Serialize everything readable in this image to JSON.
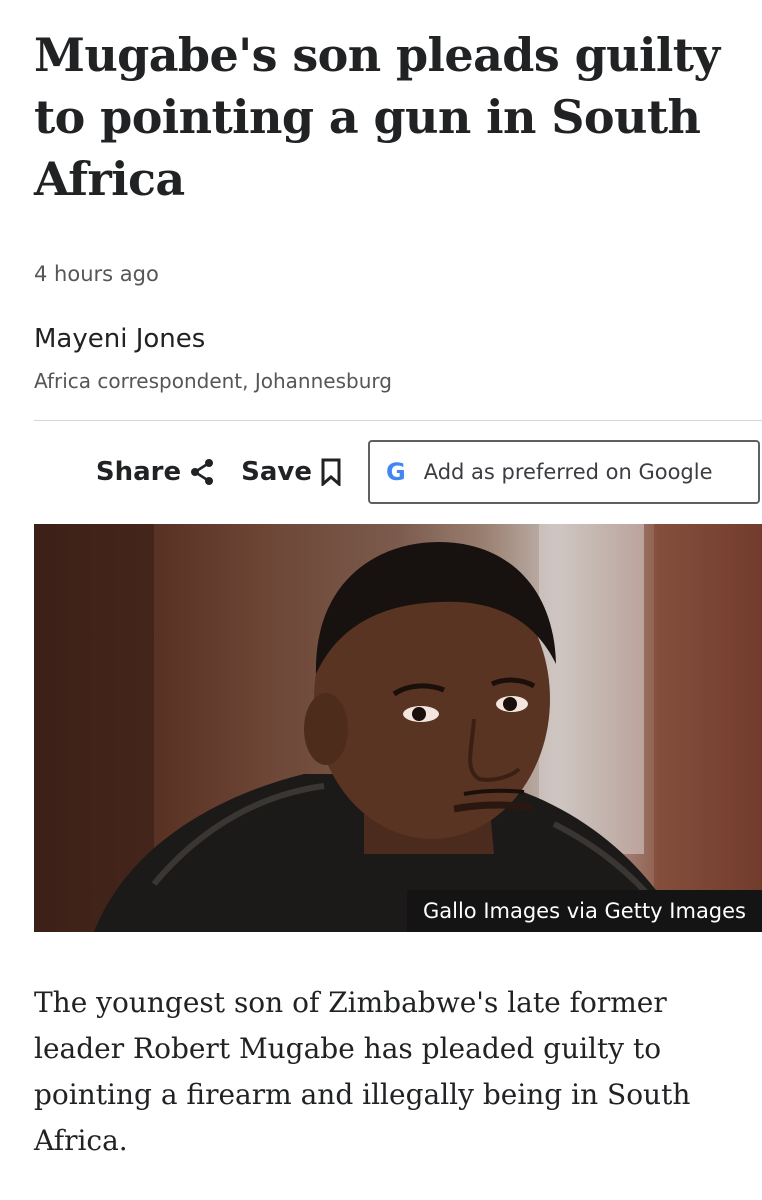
{
  "article": {
    "headline": "Mugabe's son pleads guilty to pointing a gun in South Africa",
    "timestamp": "4 hours ago",
    "author": {
      "name": "Mayeni Jones",
      "role": "Africa correspondent, Johannesburg"
    },
    "actions": {
      "share_label": "Share",
      "save_label": "Save",
      "google_label": "Add as preferred on Google",
      "google_logo": "G"
    },
    "image": {
      "caption": "Gallo Images via Getty Images"
    },
    "lead_paragraph": "The youngest son of Zimbabwe's late former leader Robert Mugabe has pleaded guilty to pointing a firearm and illegally being in South Africa."
  },
  "icons": {
    "share": "share-icon",
    "save": "bookmark-icon",
    "google": "google-logo-icon"
  },
  "colors": {
    "text": "#202224",
    "secondary_text": "#545658",
    "google_blue": "#4285f4",
    "caption_bg": "#141414"
  }
}
